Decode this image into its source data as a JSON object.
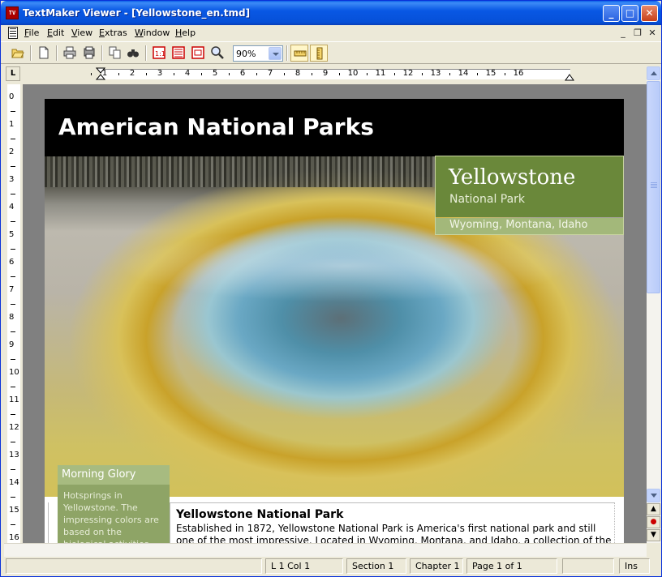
{
  "window": {
    "app_icon_text": "TV",
    "title": "TextMaker Viewer - [Yellowstone_en.tmd]",
    "controls": {
      "minimize": "_",
      "maximize": "□",
      "close": "✕"
    }
  },
  "menu": {
    "items": [
      {
        "label": "File",
        "key": "F",
        "rest": "ile"
      },
      {
        "label": "Edit",
        "key": "E",
        "rest": "dit"
      },
      {
        "label": "View",
        "key": "V",
        "rest": "iew"
      },
      {
        "label": "Extras",
        "key": "E",
        "rest": "xtras"
      },
      {
        "label": "Window",
        "key": "W",
        "rest": "indow"
      },
      {
        "label": "Help",
        "key": "H",
        "rest": "elp"
      }
    ],
    "mdi_controls": {
      "minimize": "_",
      "restore": "❐",
      "close": "✕"
    }
  },
  "toolbar": {
    "zoom": {
      "value": "90%"
    },
    "icons": [
      "open-folder-icon",
      "new-document-icon",
      "print-icon",
      "print-preview-icon",
      "copy-icon",
      "find-icon",
      "page-view-icon",
      "normal-view-icon",
      "outline-view-icon",
      "zoom-icon",
      "ruler-toggle-icon",
      "vertical-ruler-toggle-icon"
    ]
  },
  "ruler": {
    "corner_label": "L",
    "horizontal_numbers": [
      "1",
      "2",
      "3",
      "4",
      "5",
      "6",
      "7",
      "8",
      "9",
      "10",
      "11",
      "12",
      "13",
      "14",
      "15",
      "16"
    ],
    "vertical_numbers": [
      "0",
      "1",
      "2",
      "3",
      "4",
      "5",
      "6",
      "7",
      "8",
      "9",
      "10",
      "11",
      "12",
      "13",
      "14",
      "15",
      "16"
    ]
  },
  "document": {
    "banner_title": "American National Parks",
    "info": {
      "title": "Yellowstone",
      "subtitle": "National Park",
      "location": "Wyoming, Montana, Idaho"
    },
    "caption": {
      "title": "Morning Glory",
      "text": "Hotsprings in Yellowstone. The impressing colors are based on the biological activities"
    },
    "article": {
      "title": "Yellowstone National Park",
      "body": "Established in 1872, Yellowstone National Park is America's first national park and still one of the most impressive. Located in Wyoming, Montana, and Idaho, a collection of the"
    }
  },
  "status": {
    "position": "L 1 Col 1",
    "section": "Section 1",
    "chapter": "Chapter 1",
    "page": "Page 1 of 1",
    "mode": "Ins"
  },
  "colors": {
    "title_bar": "#0958e4",
    "park_green": "#6a883a",
    "caption_green": "#8ea466",
    "banner": "#000000"
  }
}
